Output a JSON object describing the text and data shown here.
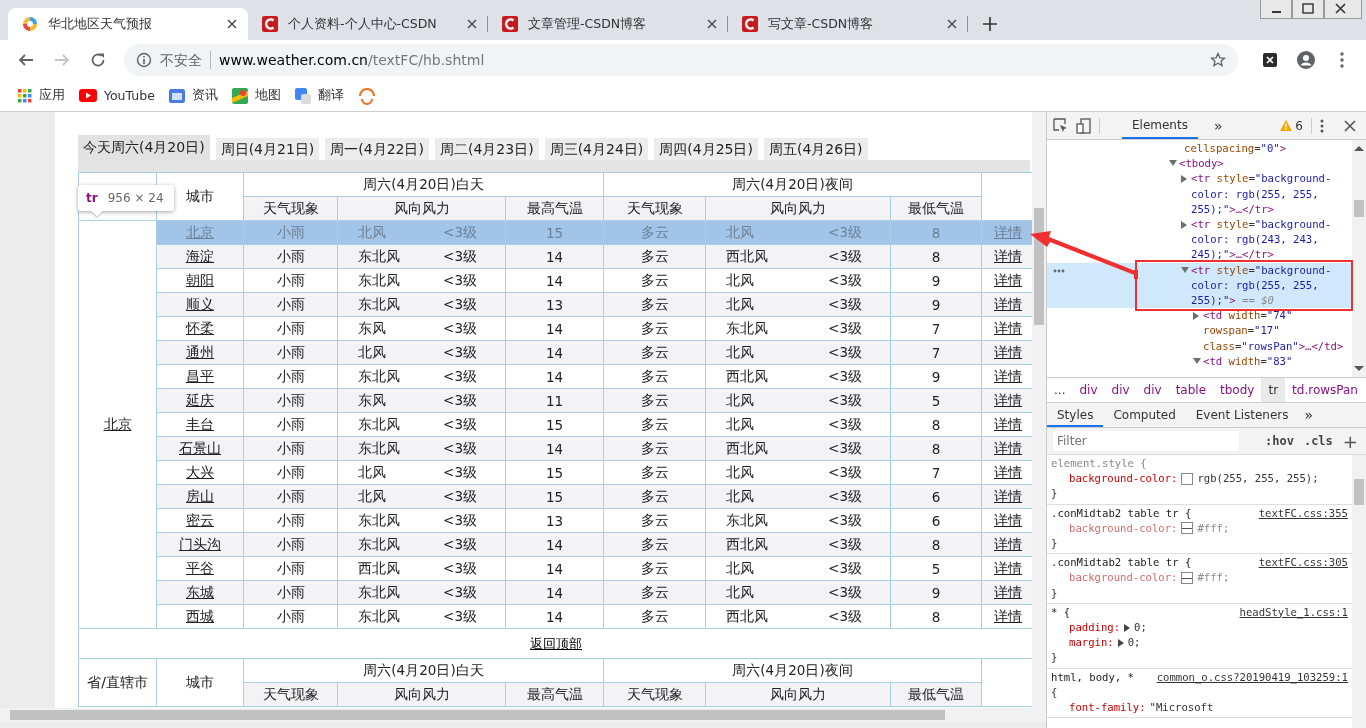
{
  "browser": {
    "tabs": [
      {
        "title": "华北地区天气预报",
        "selected": true,
        "kind": "weather"
      },
      {
        "title": "个人资料-个人中心-CSDN",
        "selected": false,
        "kind": "csdn"
      },
      {
        "title": "文章管理-CSDN博客",
        "selected": false,
        "kind": "csdn"
      },
      {
        "title": "写文章-CSDN博客",
        "selected": false,
        "kind": "csdn"
      }
    ],
    "forward": {
      "disabled": true
    },
    "address": {
      "security": "不安全",
      "host": "www.weather.com.cn",
      "path": "/textFC/hb.shtml"
    },
    "bookmarks": [
      {
        "kind": "apps",
        "label": "应用"
      },
      {
        "kind": "youtube",
        "label": "YouTube"
      },
      {
        "kind": "news",
        "label": "资讯"
      },
      {
        "kind": "maps",
        "label": "地图"
      },
      {
        "kind": "translate",
        "label": "翻译"
      },
      {
        "kind": "loader"
      }
    ]
  },
  "page": {
    "day_tabs": [
      {
        "label": "今天周六(4月20日)",
        "selected": true
      },
      {
        "label": "周日(4月21日)",
        "selected": false
      },
      {
        "label": "周一(4月22日)",
        "selected": false
      },
      {
        "label": "周二(4月23日)",
        "selected": false
      },
      {
        "label": "周三(4月24日)",
        "selected": false
      },
      {
        "label": "周四(4月25日)",
        "selected": false
      },
      {
        "label": "周五(4月26日)",
        "selected": false
      }
    ],
    "inspector_tooltip": {
      "tag": "tr",
      "size": "956 × 24"
    },
    "table": {
      "city_header": "城市",
      "day_header": "周六(4月20日)白天",
      "night_header": "周六(4月20日)夜间",
      "columns": [
        "天气现象",
        "风向风力",
        "最高气温",
        "天气现象",
        "风向风力",
        "最低气温"
      ],
      "province": "北京",
      "rows": [
        {
          "city": "北京",
          "day_weather": "小雨",
          "day_wind": "北风",
          "day_level": "<3级",
          "high": "15",
          "night_weather": "多云",
          "night_wind": "北风",
          "night_level": "<3级",
          "low": "8",
          "details": "详情",
          "highlighted": true
        },
        {
          "city": "海淀",
          "day_weather": "小雨",
          "day_wind": "东北风",
          "day_level": "<3级",
          "high": "14",
          "night_weather": "多云",
          "night_wind": "西北风",
          "night_level": "<3级",
          "low": "8",
          "details": "详情",
          "highlighted": false
        },
        {
          "city": "朝阳",
          "day_weather": "小雨",
          "day_wind": "东北风",
          "day_level": "<3级",
          "high": "14",
          "night_weather": "多云",
          "night_wind": "北风",
          "night_level": "<3级",
          "low": "9",
          "details": "详情",
          "highlighted": false
        },
        {
          "city": "顺义",
          "day_weather": "小雨",
          "day_wind": "东北风",
          "day_level": "<3级",
          "high": "13",
          "night_weather": "多云",
          "night_wind": "北风",
          "night_level": "<3级",
          "low": "9",
          "details": "详情",
          "highlighted": false
        },
        {
          "city": "怀柔",
          "day_weather": "小雨",
          "day_wind": "东风",
          "day_level": "<3级",
          "high": "14",
          "night_weather": "多云",
          "night_wind": "东北风",
          "night_level": "<3级",
          "low": "7",
          "details": "详情",
          "highlighted": false
        },
        {
          "city": "通州",
          "day_weather": "小雨",
          "day_wind": "北风",
          "day_level": "<3级",
          "high": "14",
          "night_weather": "多云",
          "night_wind": "北风",
          "night_level": "<3级",
          "low": "7",
          "details": "详情",
          "highlighted": false
        },
        {
          "city": "昌平",
          "day_weather": "小雨",
          "day_wind": "东北风",
          "day_level": "<3级",
          "high": "14",
          "night_weather": "多云",
          "night_wind": "西北风",
          "night_level": "<3级",
          "low": "9",
          "details": "详情",
          "highlighted": false
        },
        {
          "city": "延庆",
          "day_weather": "小雨",
          "day_wind": "东风",
          "day_level": "<3级",
          "high": "11",
          "night_weather": "多云",
          "night_wind": "北风",
          "night_level": "<3级",
          "low": "5",
          "details": "详情",
          "highlighted": false
        },
        {
          "city": "丰台",
          "day_weather": "小雨",
          "day_wind": "东北风",
          "day_level": "<3级",
          "high": "15",
          "night_weather": "多云",
          "night_wind": "北风",
          "night_level": "<3级",
          "low": "8",
          "details": "详情",
          "highlighted": false
        },
        {
          "city": "石景山",
          "day_weather": "小雨",
          "day_wind": "东北风",
          "day_level": "<3级",
          "high": "14",
          "night_weather": "多云",
          "night_wind": "西北风",
          "night_level": "<3级",
          "low": "8",
          "details": "详情",
          "highlighted": false
        },
        {
          "city": "大兴",
          "day_weather": "小雨",
          "day_wind": "北风",
          "day_level": "<3级",
          "high": "15",
          "night_weather": "多云",
          "night_wind": "北风",
          "night_level": "<3级",
          "low": "7",
          "details": "详情",
          "highlighted": false
        },
        {
          "city": "房山",
          "day_weather": "小雨",
          "day_wind": "北风",
          "day_level": "<3级",
          "high": "15",
          "night_weather": "多云",
          "night_wind": "北风",
          "night_level": "<3级",
          "low": "6",
          "details": "详情",
          "highlighted": false
        },
        {
          "city": "密云",
          "day_weather": "小雨",
          "day_wind": "东北风",
          "day_level": "<3级",
          "high": "13",
          "night_weather": "多云",
          "night_wind": "东北风",
          "night_level": "<3级",
          "low": "6",
          "details": "详情",
          "highlighted": false
        },
        {
          "city": "门头沟",
          "day_weather": "小雨",
          "day_wind": "东北风",
          "day_level": "<3级",
          "high": "14",
          "night_weather": "多云",
          "night_wind": "西北风",
          "night_level": "<3级",
          "low": "8",
          "details": "详情",
          "highlighted": false
        },
        {
          "city": "平谷",
          "day_weather": "小雨",
          "day_wind": "西北风",
          "day_level": "<3级",
          "high": "14",
          "night_weather": "多云",
          "night_wind": "北风",
          "night_level": "<3级",
          "low": "5",
          "details": "详情",
          "highlighted": false
        },
        {
          "city": "东城",
          "day_weather": "小雨",
          "day_wind": "东北风",
          "day_level": "<3级",
          "high": "14",
          "night_weather": "多云",
          "night_wind": "北风",
          "night_level": "<3级",
          "low": "9",
          "details": "详情",
          "highlighted": false
        },
        {
          "city": "西城",
          "day_weather": "小雨",
          "day_wind": "东北风",
          "day_level": "<3级",
          "high": "14",
          "night_weather": "多云",
          "night_wind": "西北风",
          "night_level": "<3级",
          "low": "8",
          "details": "详情",
          "highlighted": false
        }
      ]
    },
    "back_to_top": "返回顶部",
    "next_table": {
      "province_header": "省/直辖市",
      "city_header": "城市",
      "day_header": "周六(4月20日)白天",
      "night_header": "周六(4月20日)夜间",
      "columns": [
        "天气现象",
        "风向风力",
        "最高气温",
        "天气现象",
        "风向风力",
        "最低气温"
      ]
    }
  },
  "devtools": {
    "tabs": [
      {
        "label": "Elements",
        "selected": true
      }
    ],
    "more": "»",
    "warnings": "6",
    "tree": [
      {
        "parts": [
          {
            "kind": "attr",
            "text": "cellspacing"
          },
          {
            "kind": "plain",
            "text": "="
          },
          {
            "kind": "value",
            "text": "\"0\""
          },
          {
            "kind": "tag",
            "text": ">"
          }
        ]
      },
      {
        "expanded": true,
        "selected": false,
        "parts": [
          {
            "kind": "tag",
            "text": "<tbody>"
          }
        ],
        "children": [
          {
            "expanded": false,
            "selected": false,
            "parts": [
              {
                "kind": "tag",
                "text": "<tr"
              },
              {
                "kind": "attr",
                "text": " style"
              },
              {
                "kind": "plain",
                "text": "="
              },
              {
                "kind": "value",
                "text": "\"background-color: rgb(255, 255, 255);\""
              },
              {
                "kind": "tag",
                "text": ">…</tr>"
              }
            ]
          },
          {
            "expanded": false,
            "selected": false,
            "parts": [
              {
                "kind": "tag",
                "text": "<tr"
              },
              {
                "kind": "attr",
                "text": " style"
              },
              {
                "kind": "plain",
                "text": "="
              },
              {
                "kind": "value",
                "text": "\"background-color: rgb(243, 243, 245);\""
              },
              {
                "kind": "tag",
                "text": ">…</tr>"
              }
            ]
          },
          {
            "expanded": true,
            "selected": true,
            "parts": [
              {
                "kind": "tag",
                "text": "<tr"
              },
              {
                "kind": "attr",
                "text": " style"
              },
              {
                "kind": "plain",
                "text": "="
              },
              {
                "kind": "value",
                "text": "\"background-color: rgb(255, 255, 255);\""
              },
              {
                "kind": "tag",
                "text": ">"
              },
              {
                "kind": "hint",
                "text": " == $0"
              }
            ],
            "children": [
              {
                "expanded": false,
                "selected": false,
                "parts": [
                  {
                    "kind": "tag",
                    "text": "<td"
                  },
                  {
                    "kind": "attr",
                    "text": " width"
                  },
                  {
                    "kind": "plain",
                    "text": "="
                  },
                  {
                    "kind": "value",
                    "text": "\"74\""
                  },
                  {
                    "kind": "attr",
                    "text": " rowspan"
                  },
                  {
                    "kind": "plain",
                    "text": "="
                  },
                  {
                    "kind": "value",
                    "text": "\"17\""
                  },
                  {
                    "kind": "attr",
                    "text": " class"
                  },
                  {
                    "kind": "plain",
                    "text": "="
                  },
                  {
                    "kind": "value",
                    "text": "\"rowsPan\""
                  },
                  {
                    "kind": "tag",
                    "text": ">…</td>"
                  }
                ]
              },
              {
                "expanded": true,
                "selected": false,
                "parts": [
                  {
                    "kind": "tag",
                    "text": "<td"
                  },
                  {
                    "kind": "attr",
                    "text": " width"
                  },
                  {
                    "kind": "plain",
                    "text": "="
                  },
                  {
                    "kind": "value",
                    "text": "\"83\""
                  }
                ]
              }
            ]
          }
        ]
      }
    ],
    "breadcrumbs": [
      {
        "label": "...",
        "selected": false
      },
      {
        "label": "div",
        "selected": false
      },
      {
        "label": "div",
        "selected": false
      },
      {
        "label": "div",
        "selected": false
      },
      {
        "label": "table",
        "selected": false
      },
      {
        "label": "tbody",
        "selected": false
      },
      {
        "label": "tr",
        "selected": true
      },
      {
        "label": "td.rowsPan",
        "selected": false
      }
    ],
    "style_tabs": [
      {
        "label": "Styles",
        "selected": true
      },
      {
        "label": "Computed",
        "selected": false
      },
      {
        "label": "Event Listeners",
        "selected": false
      }
    ],
    "more_style_tabs": "»",
    "filter": {
      "placeholder": "Filter"
    },
    "hov": ":hov",
    "cls": ".cls",
    "add": "+",
    "rules": [
      {
        "selector": "element.style {",
        "declarations": [
          {
            "property": "background-color:",
            "color": "#ffffff",
            "value": "rgb(255, 255, 255);",
            "struck": false,
            "expandable": false
          }
        ],
        "close": "}"
      },
      {
        "selector": ".conMidtab2 table tr {",
        "source": "textFC.css:355",
        "declarations": [
          {
            "property": "background-color:",
            "color": "#ffffff",
            "value": "#fff;",
            "struck": true,
            "expandable": false
          }
        ],
        "close": "}"
      },
      {
        "selector": ".conMidtab2 table tr {",
        "source": "textFC.css:305",
        "declarations": [
          {
            "property": "background-color:",
            "color": "#ffffff",
            "value": "#fff;",
            "struck": true,
            "expandable": false
          }
        ],
        "close": "}"
      },
      {
        "selector": "* {",
        "source": "headStyle_1.css:1",
        "declarations": [
          {
            "property": "padding:",
            "value": "0;",
            "struck": false,
            "expandable": true
          },
          {
            "property": "margin:",
            "value": "0;",
            "struck": false,
            "expandable": true
          }
        ],
        "close": "}"
      },
      {
        "selector": "html, body, *",
        "source": "common_o.css?20190419_103259:1",
        "open_line": "{",
        "declarations": [
          {
            "property": "font-family:",
            "value": "\"Microsoft",
            "struck": false,
            "expandable": false
          }
        ]
      }
    ]
  }
}
